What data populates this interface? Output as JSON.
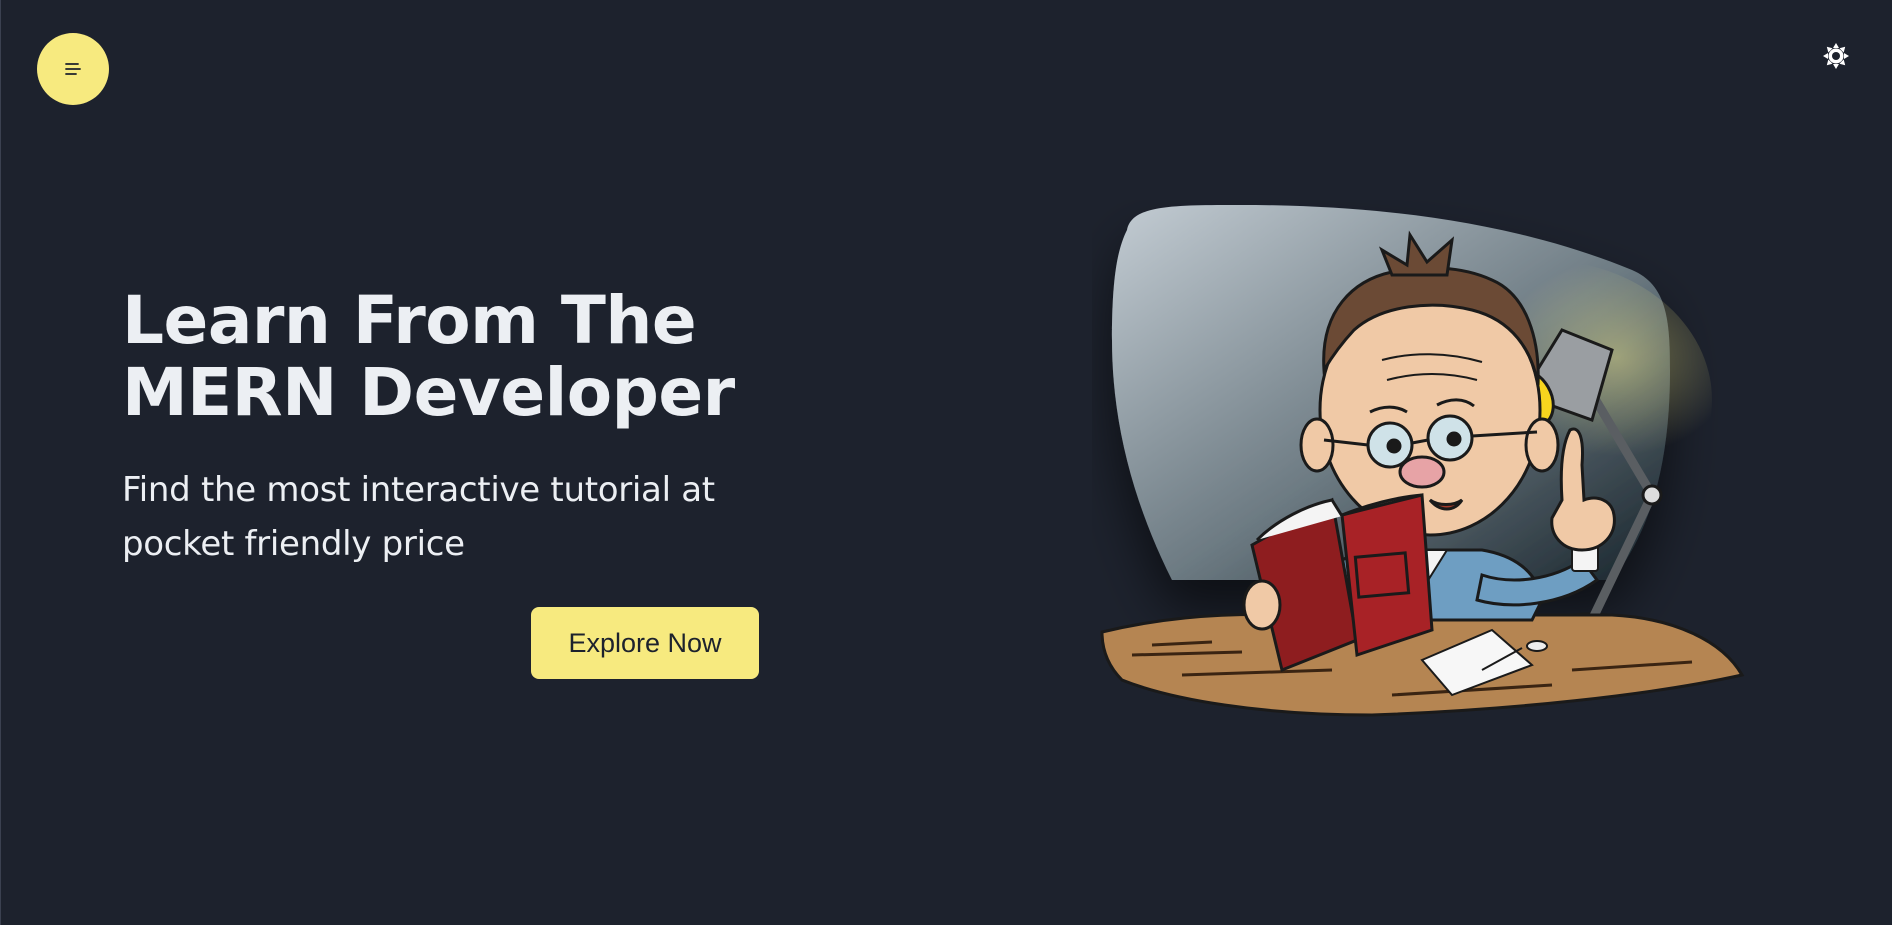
{
  "header": {
    "menu_icon": "menu-lines-icon",
    "theme_icon": "sun-icon"
  },
  "hero": {
    "headline_line1": "Learn From The",
    "headline_line2": "MERN Developer",
    "subtitle_line1": "Find the most interactive tutorial at",
    "subtitle_line2": "pocket friendly price",
    "cta_label": "Explore Now"
  },
  "illustration": {
    "subject": "cartoon-teacher-reading-book-icon"
  },
  "colors": {
    "background": "#1d222d",
    "accent": "#f7ea7f",
    "text": "#eceff3"
  }
}
